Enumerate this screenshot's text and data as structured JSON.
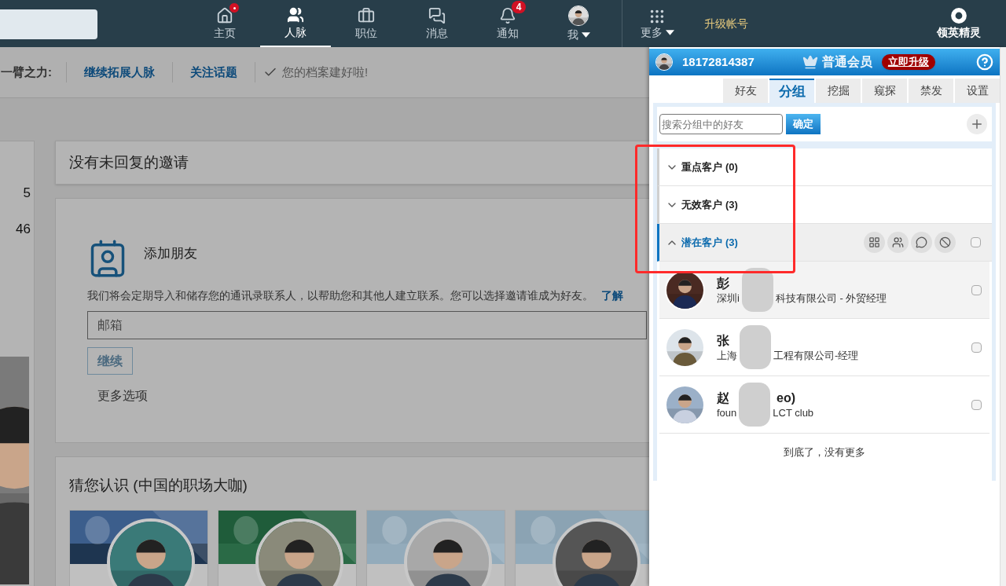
{
  "nav": {
    "items": [
      {
        "label": "主页",
        "selected": false,
        "dot": true
      },
      {
        "label": "人脉",
        "selected": true,
        "dot": false
      },
      {
        "label": "职位",
        "selected": false,
        "dot": false
      },
      {
        "label": "消息",
        "selected": false,
        "dot": false
      },
      {
        "label": "通知",
        "selected": false,
        "dot": false,
        "badge": "4"
      },
      {
        "label": "我",
        "selected": false,
        "dot": false
      }
    ],
    "more": "更多",
    "upgrade": "升级帐号",
    "extension": "领英精灵"
  },
  "subbar": {
    "lead": "一臂之力:",
    "links": [
      "继续拓展人脉",
      "关注话题"
    ],
    "status": "您的档案建好啦!"
  },
  "left_card": {
    "stats": [
      "5",
      "46"
    ]
  },
  "invitations": {
    "title": "没有未回复的邀请"
  },
  "add_friends": {
    "title": "添加朋友",
    "description": "我们将会定期导入和储存您的通讯录联系人，以帮助您和其他人建立联系。您可以选择邀请谁成为好友。",
    "link": "了解",
    "email_placeholder": "邮箱",
    "continue_button": "继续",
    "more_options": "更多选项"
  },
  "pymk": {
    "title": "猜您认识 (中国的职场大咖)"
  },
  "panel": {
    "phone": "18172814387",
    "membership": "普通会员",
    "upgrade": "立即升级",
    "tabs": [
      {
        "label": "好友",
        "selected": false
      },
      {
        "label": "分组",
        "selected": true
      },
      {
        "label": "挖掘",
        "selected": false
      },
      {
        "label": "窥探",
        "selected": false
      },
      {
        "label": "禁发",
        "selected": false
      },
      {
        "label": "设置",
        "selected": false
      }
    ],
    "search_placeholder": "搜索分组中的好友",
    "confirm": "确定",
    "groups": [
      {
        "name": "重点客户",
        "count": "(0)",
        "expanded": false
      },
      {
        "name": "无效客户",
        "count": "(3)",
        "expanded": false
      },
      {
        "name": "潜在客户",
        "count": "(3)",
        "expanded": true
      }
    ],
    "contacts": [
      {
        "name": [
          "彭"
        ],
        "company": [
          "深圳i",
          "科技有限公司 - 外贸经理"
        ],
        "highlighted": true,
        "checked": false
      },
      {
        "name": [
          "张"
        ],
        "company": [
          "上海",
          "工程有限公司-经理"
        ],
        "highlighted": false,
        "checked": false
      },
      {
        "name": [
          "赵",
          "eo)"
        ],
        "company": [
          "foun",
          "LCT club"
        ],
        "highlighted": false,
        "checked": false
      }
    ],
    "end_text": "到底了，没有更多"
  }
}
